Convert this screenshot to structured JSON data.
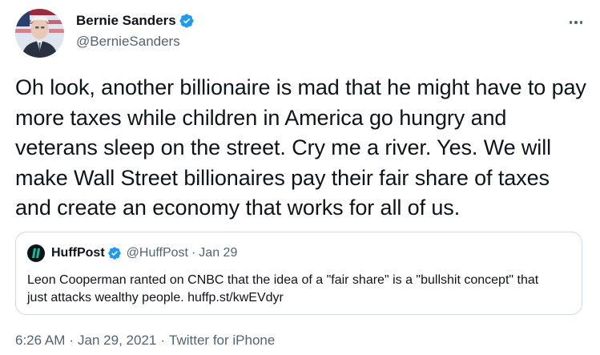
{
  "author": {
    "display_name": "Bernie Sanders",
    "handle": "@BernieSanders",
    "verified": true,
    "avatar_icon": "profile-photo"
  },
  "tweet": {
    "text": "Oh look, another billionaire is mad that he might have to pay more taxes while children in America go hungry and veterans sleep on the street. Cry me a river. Yes. We will make Wall Street billionaires pay their fair share of taxes and create an economy that works for all of us."
  },
  "quoted_tweet": {
    "display_name": "HuffPost",
    "handle": "@HuffPost",
    "separator": "·",
    "date": "Jan 29",
    "verified": true,
    "text": "Leon Cooperman ranted on CNBC that the idea of a \"fair share\" is a \"bullshit concept\" that just attacks wealthy people. huffp.st/kwEVdyr"
  },
  "meta": {
    "time": "6:26 AM",
    "separator_1": "·",
    "date": "Jan 29, 2021",
    "separator_2": "·",
    "source": "Twitter for iPhone"
  },
  "colors": {
    "verified_blue": "#1d9bf0",
    "secondary_text": "#536471",
    "border": "#cfd9de",
    "huffpost_green": "#0dbe98"
  }
}
